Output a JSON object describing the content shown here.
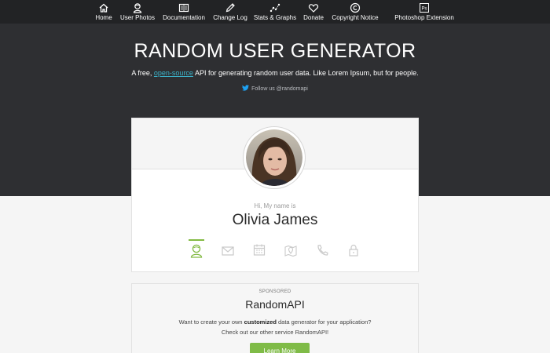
{
  "nav": {
    "items": [
      {
        "label": "Home",
        "icon": "home-icon"
      },
      {
        "label": "User Photos",
        "icon": "user-photos-icon"
      },
      {
        "label": "Documentation",
        "icon": "documentation-icon"
      },
      {
        "label": "Change Log",
        "icon": "pencil-icon"
      },
      {
        "label": "Stats & Graphs",
        "icon": "stats-icon"
      },
      {
        "label": "Donate",
        "icon": "heart-icon"
      },
      {
        "label": "Copyright Notice",
        "icon": "copyright-icon"
      },
      {
        "label": "Photoshop Extension",
        "icon": "photoshop-icon",
        "icon_text": "Ps"
      }
    ]
  },
  "hero": {
    "title": "RANDOM USER GENERATOR",
    "subtitle_prefix": "A free, ",
    "subtitle_link": "open-source",
    "subtitle_suffix": " API for generating random user data. Like Lorem Ipsum, but for people.",
    "follow_text": "Follow us @randomapi"
  },
  "profile": {
    "intro": "Hi, My name is",
    "name": "Olivia James",
    "tabs": [
      "user-icon",
      "email-icon",
      "calendar-icon",
      "map-icon",
      "phone-icon",
      "lock-icon"
    ],
    "active_tab": "user-icon"
  },
  "sponsored": {
    "label": "SPONSORED",
    "title": "RandomAPI",
    "line1_prefix": "Want to create your own ",
    "line1_bold": "customized",
    "line1_suffix": " data generator for your application?",
    "line2": "Check out our other service RandomAPI!",
    "button": "Learn More"
  },
  "colors": {
    "nav_bg": "#222325",
    "hero_bg": "#2e2f32",
    "link": "#3bb2c9",
    "accent_green": "#83ba43",
    "icon_gray": "#c9c9c9"
  }
}
